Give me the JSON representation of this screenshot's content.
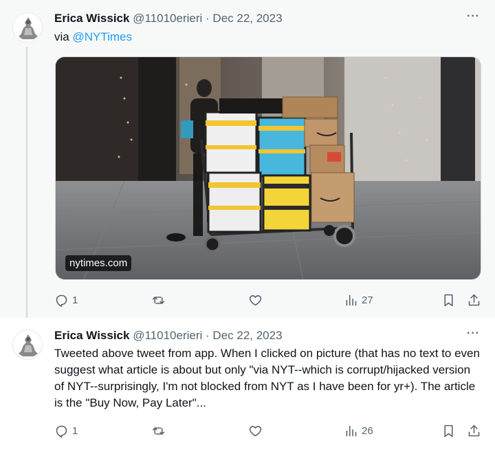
{
  "tweets": [
    {
      "author": "Erica Wissick",
      "handle": "@11010erieri",
      "separator": "·",
      "date": "Dec 22, 2023",
      "text_prefix": "via ",
      "mention": "@NYTimes",
      "media_domain": "nytimes.com",
      "more": "···",
      "stats": {
        "replies": "1",
        "views": "27"
      }
    },
    {
      "author": "Erica Wissick",
      "handle": "@11010erieri",
      "separator": "·",
      "date": "Dec 22, 2023",
      "text": "Tweeted above tweet from app. When I clicked on picture (that has no text to even suggest what article is about but only \"via NYT--which is corrupt/hijacked version of NYT--surprisingly, I'm not blocked from NYT as I have been for yr+). The article is the \"Buy Now, Pay Later\"...",
      "more": "···",
      "stats": {
        "replies": "1",
        "views": "26"
      }
    }
  ],
  "colors": {
    "text": "#0f1419",
    "secondary": "#536471",
    "link": "#1d9bf0",
    "thread_line": "#cfd9de",
    "highlight_bg": "#f7f9f9"
  }
}
